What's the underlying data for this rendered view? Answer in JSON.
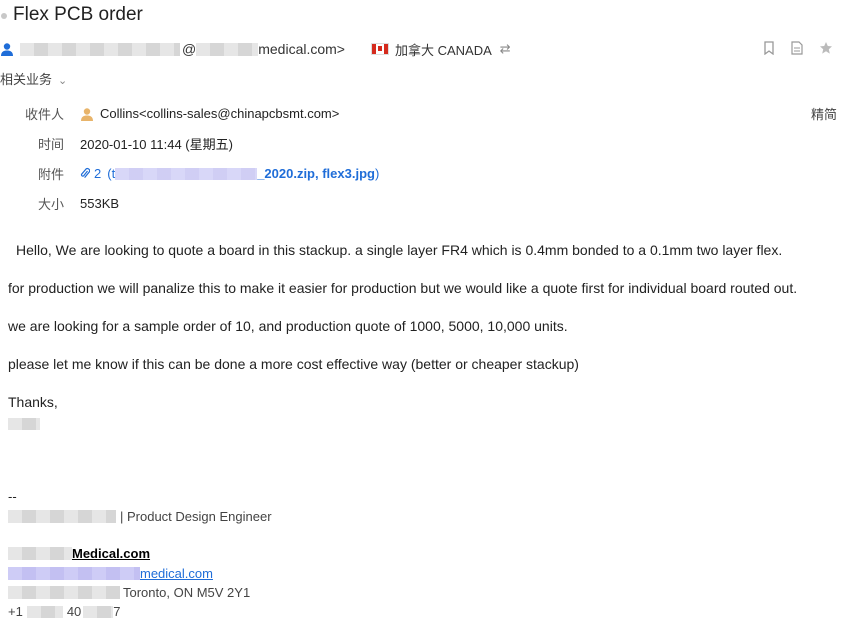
{
  "email": {
    "subject": "Flex PCB order",
    "sender_domain": "medical.com>",
    "sender_at": "@",
    "country": "加拿大 CANADA",
    "related": "相关业务",
    "fields": {
      "to_label": "收件人",
      "to_value": "Collins<collins-sales@chinapcbsmt.com>",
      "time_label": "时间",
      "time_value": "2020-01-10 11:44 (星期五)",
      "attach_label": "附件",
      "attach_count": "2",
      "attach_open": "(t",
      "attach_files": "_2020.zip, flex3.jpg",
      "attach_close": ")",
      "size_label": "大小",
      "size_value": "553KB"
    },
    "precise": "精简",
    "body": {
      "p1": "Hello, We are looking to quote a board in this stackup. a single layer FR4 which is 0.4mm bonded to a 0.1mm two layer flex.",
      "p2": "for production we will panalize this to make it easier for production but we would like a quote first for individual board routed out.",
      "p3": "we are looking for a sample order of 10, and production quote of 1000, 5000, 10,000 units.",
      "p4": "please let me know if this can be done a more cost effective way (better or cheaper stackup)",
      "thanks": "Thanks,"
    },
    "signature": {
      "dashes": "--",
      "role": "| Product Design Engineer",
      "company": "Medical.com",
      "email_domain": "medical.com",
      "address": "Toronto, ON  M5V 2Y1",
      "phone_a": "+1",
      "phone_b": "40",
      "phone_c": "7"
    }
  },
  "icons": [
    "person-icon",
    "canada-flag-icon",
    "link-icon",
    "bookmark-icon",
    "note-icon",
    "star-icon",
    "chevron-down-icon",
    "contact-icon",
    "paperclip-icon"
  ]
}
